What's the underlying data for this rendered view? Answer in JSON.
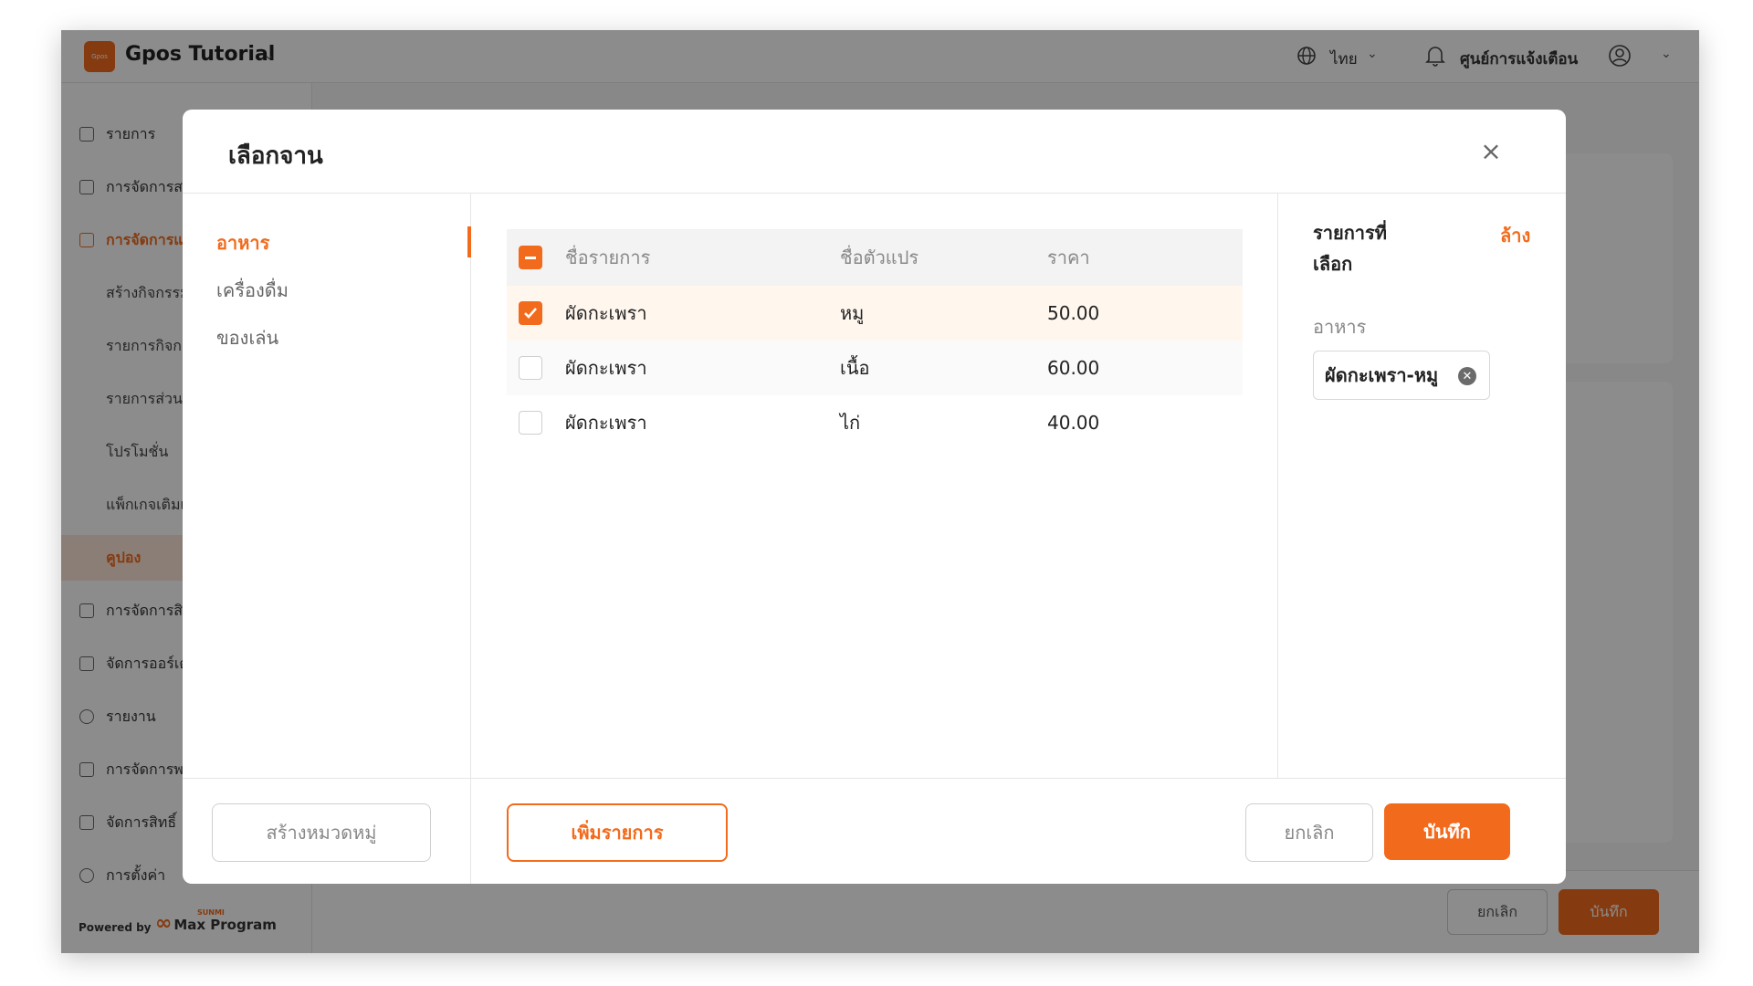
{
  "app": {
    "logo_text": "Gpos",
    "title": "Gpos Tutorial",
    "language": "ไทย",
    "notifications_label": "ศูนย์การแจ้งเตือน",
    "accent_color": "#f26b1d"
  },
  "sidebar": {
    "items": [
      {
        "label": "รายการ"
      },
      {
        "label": "การจัดการสาขา"
      },
      {
        "label": "การจัดการแคมเปญ"
      },
      {
        "label": "สร้างกิจกรรม"
      },
      {
        "label": "รายการกิจกรรม"
      },
      {
        "label": "รายการส่วนลด"
      },
      {
        "label": "โปรโมชั่น"
      },
      {
        "label": "แพ็กเกจเติมเงิน"
      },
      {
        "label": "คูปอง"
      },
      {
        "label": "การจัดการสินค้า"
      },
      {
        "label": "จัดการออร์เดอร์"
      },
      {
        "label": "รายงาน"
      },
      {
        "label": "การจัดการพนักงาน"
      },
      {
        "label": "จัดการสิทธิ์"
      },
      {
        "label": "การตั้งค่า"
      }
    ],
    "powered_by": "Powered by",
    "brand_small": "SUNMI",
    "brand": "Max Program"
  },
  "background_footer": {
    "cancel_label": "ยกเลิก",
    "save_label": "บันทึก"
  },
  "modal": {
    "title": "เลือกจาน",
    "categories": [
      {
        "label": "อาหาร",
        "active": true
      },
      {
        "label": "เครื่องดื่ม",
        "active": false
      },
      {
        "label": "ของเล่น",
        "active": false
      }
    ],
    "table": {
      "headers": {
        "name": "ชื่อรายการ",
        "variant": "ชื่อตัวแปร",
        "price": "ราคา"
      },
      "rows": [
        {
          "name": "ผัดกะเพรา",
          "variant": "หมู",
          "price": "50.00",
          "checked": true
        },
        {
          "name": "ผัดกะเพรา",
          "variant": "เนื้อ",
          "price": "60.00",
          "checked": false
        },
        {
          "name": "ผัดกะเพรา",
          "variant": "ไก่",
          "price": "40.00",
          "checked": false
        }
      ]
    },
    "selected_panel": {
      "title": "รายการที่เลือก",
      "clear_label": "ล้าง",
      "group_label": "อาหาร",
      "tags": [
        {
          "label": "ผัดกะเพรา-หมู"
        }
      ]
    },
    "footer": {
      "create_category_label": "สร้างหมวดหมู่",
      "add_item_label": "เพิ่มรายการ",
      "cancel_label": "ยกเลิก",
      "save_label": "บันทึก"
    }
  }
}
